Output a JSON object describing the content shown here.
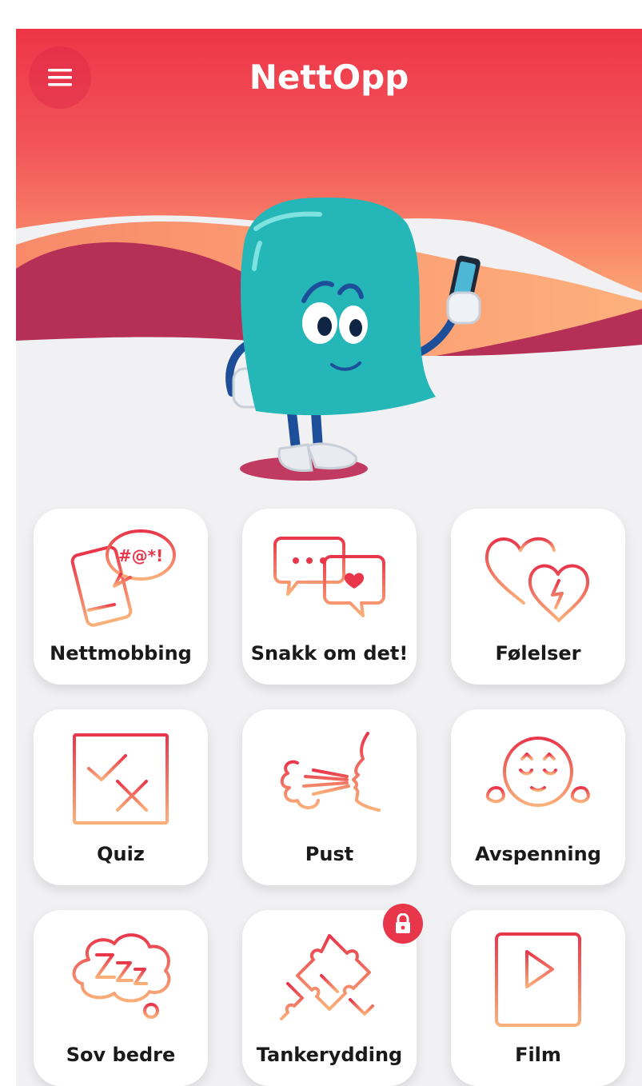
{
  "header": {
    "title": "NettOpp",
    "menu_icon": "hamburger-menu-icon"
  },
  "colors": {
    "header_top": "#ee3a4c",
    "header_mid": "#f47066",
    "wave_dark": "#b52f57",
    "wave_light": "#fca073",
    "tile_icon_start": "#e8364a",
    "tile_icon_end": "#fbb07a",
    "background": "#f1f1f3"
  },
  "tiles": [
    {
      "label": "Nettmobbing",
      "icon": "phone-swearing-icon",
      "locked": false
    },
    {
      "label": "Snakk om det!",
      "icon": "chat-bubbles-icon",
      "locked": false
    },
    {
      "label": "Følelser",
      "icon": "hearts-icon",
      "locked": false
    },
    {
      "label": "Quiz",
      "icon": "quiz-check-icon",
      "locked": false
    },
    {
      "label": "Pust",
      "icon": "breathe-icon",
      "locked": false
    },
    {
      "label": "Avspenning",
      "icon": "relaxed-face-icon",
      "locked": false
    },
    {
      "label": "Sov bedre",
      "icon": "sleep-cloud-icon",
      "locked": false
    },
    {
      "label": "Tankerydding",
      "icon": "puzzle-icon",
      "locked": true
    },
    {
      "label": "Film",
      "icon": "video-play-icon",
      "locked": false
    }
  ],
  "badge_glyphs": {
    "swear": "#@*!"
  }
}
